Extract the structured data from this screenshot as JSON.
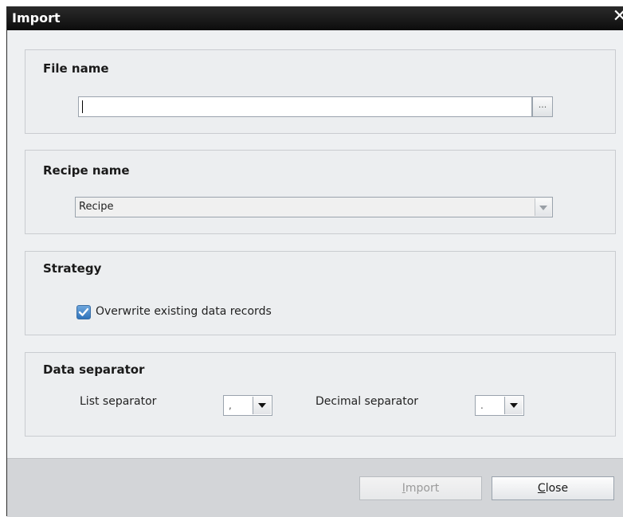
{
  "dialog": {
    "title": "Import",
    "close_glyph": "✕"
  },
  "file_name": {
    "section_title": "File name",
    "value": "",
    "browse_label": "..."
  },
  "recipe_name": {
    "section_title": "Recipe name",
    "selected": "Recipe"
  },
  "strategy": {
    "section_title": "Strategy",
    "checkbox_label": "Overwrite existing data records",
    "checked": true
  },
  "data_separator": {
    "section_title": "Data separator",
    "list_separator_label": "List separator",
    "list_separator_value": ",",
    "decimal_separator_label": "Decimal separator",
    "decimal_separator_value": "."
  },
  "footer": {
    "import_prefix": "",
    "import_mnemonic": "I",
    "import_rest": "mport",
    "close_mnemonic": "C",
    "close_rest": "lose"
  }
}
